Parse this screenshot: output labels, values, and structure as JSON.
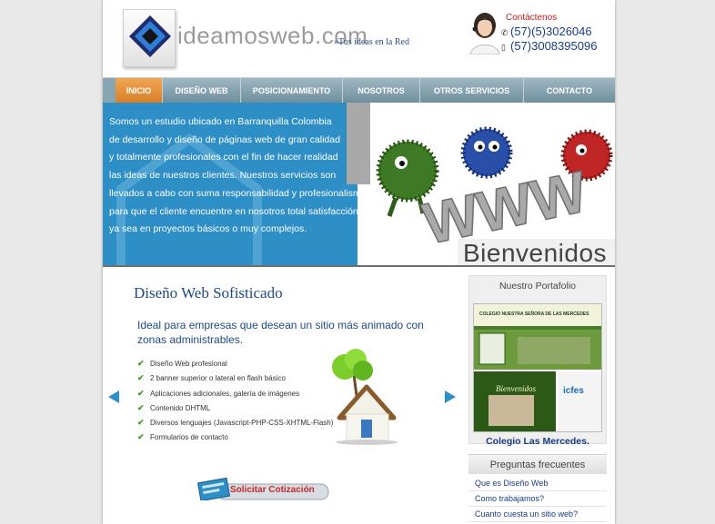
{
  "header": {
    "logo_text": "ideamosweb.com",
    "tagline": "»Tus ideas en la Red",
    "contact_label": "Contáctenos",
    "phone_1": "(57)(5)3026046",
    "phone_2": "(57)3008395096"
  },
  "nav": {
    "items": [
      "INICIO",
      "DISEÑO WEB",
      "POSICIONAMIENTO",
      "NOSOTROS",
      "OTROS SERVICIOS",
      "CONTACTO"
    ],
    "active_index": 0
  },
  "banner": {
    "lines": [
      "Somos un estudio ubicado en Barranquilla Colombia",
      "de desarrollo y diseño de páginas web de gran calidad",
      "y totalmente profesionales con el fin de hacer realidad",
      "las ideas de nuestros clientes. Nuestros servicios son",
      "llevados a cabo con suma responsabilidad y profesionalismo",
      "para que el cliente encuentre en nosotros total satisfacción",
      "ya sea en proyectos básicos o muy complejos."
    ],
    "www_text": "WWW",
    "welcome": "Bienvenidos"
  },
  "main": {
    "title": "Diseño Web Sofisticado",
    "subtitle": "Ideal para empresas que desean un sitio más animado con zonas administrables.",
    "features": [
      "Diseño Web profesional",
      "2 banner superior o lateral en flash básico",
      "Aplicaciones adicionales, galería de imágenes",
      "Contenido DHTML",
      "Diversos lenguajes (Javascript-PHP-CSS-XHTML-Flash)",
      "Formularios de contacto"
    ],
    "quote_button": "Solicitar Cotización"
  },
  "sidebar": {
    "portfolio_title": "Nuestro Portafolio",
    "portfolio_thumb": {
      "header": "COLEGIO NUESTRA SEÑORA DE LAS MERCEDES",
      "welcome": "Bienvenidos",
      "ad": "icfes"
    },
    "portfolio_caption": "Colegio Las Mercedes.",
    "faq_title": "Preguntas frecuentes",
    "faq": [
      "Que es Diseño Web",
      "Como trabajamos?",
      "Cuanto cuesta un sitio web?"
    ]
  },
  "colors": {
    "nav": "#7f9eab",
    "nav_active": "#e38a33",
    "banner_blue": "#2e8ec6",
    "link_blue": "#1a3c86",
    "check_green": "#3d9a28"
  },
  "icons": [
    "logo-diamond-icon",
    "phone-icon",
    "mobile-icon",
    "check-icon",
    "arrow-left-icon",
    "arrow-right-icon",
    "house-icon"
  ]
}
